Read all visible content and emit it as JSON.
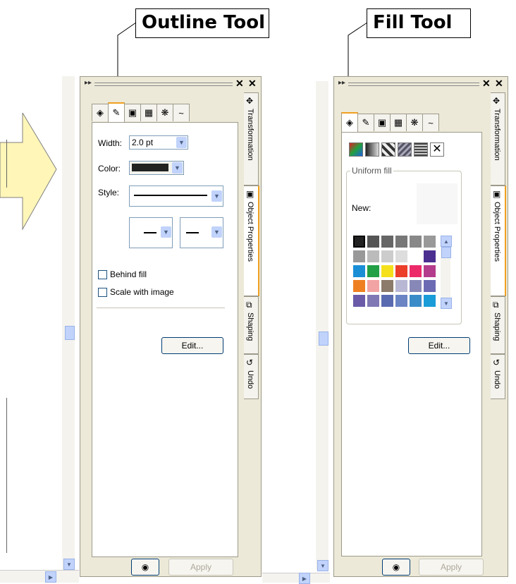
{
  "callouts": {
    "outline": "Outline Tool",
    "fill": "Fill Tool"
  },
  "docker_tabs": [
    "Transformation",
    "Object Properties",
    "Shaping",
    "Undo"
  ],
  "outline_panel": {
    "width_label": "Width:",
    "width_value": "2.0 pt",
    "color_label": "Color:",
    "style_label": "Style:",
    "behind_fill": "Behind fill",
    "scale_with_image": "Scale with image",
    "edit_button": "Edit...",
    "apply_button": "Apply"
  },
  "fill_panel": {
    "group_label": "Uniform fill",
    "new_label": "New:",
    "edit_button": "Edit...",
    "apply_button": "Apply",
    "palette": [
      [
        "#222222",
        "#555555",
        "#666666",
        "#777777",
        "#888888",
        "#999999"
      ],
      [
        "#999999",
        "#bbbbbb",
        "#cccccc",
        "#dddddd",
        "#ffffff",
        "#4b2f90"
      ],
      [
        "#1a8fd6",
        "#22a046",
        "#f4e11c",
        "#ec3f2a",
        "#ec2a6a",
        "#b43c8c"
      ],
      [
        "#ef8022",
        "#f2a3a3",
        "#8c7a6a",
        "#b8b8d4",
        "#8888b8",
        "#6b6bb4"
      ],
      [
        "#6a5aa8",
        "#8078b4",
        "#5a6ab0",
        "#6a84c4",
        "#3a8cc8",
        "#1a9cd8"
      ]
    ]
  },
  "colors": {
    "accent": "#f0a020",
    "callout_arrow": "#fff6b8",
    "panel_bg": "#ece9d8"
  },
  "icons": [
    "fill-icon",
    "outline-pen-icon",
    "size-icon",
    "transform-icon",
    "effects-icon",
    "curve-icon",
    "lock-icon"
  ]
}
